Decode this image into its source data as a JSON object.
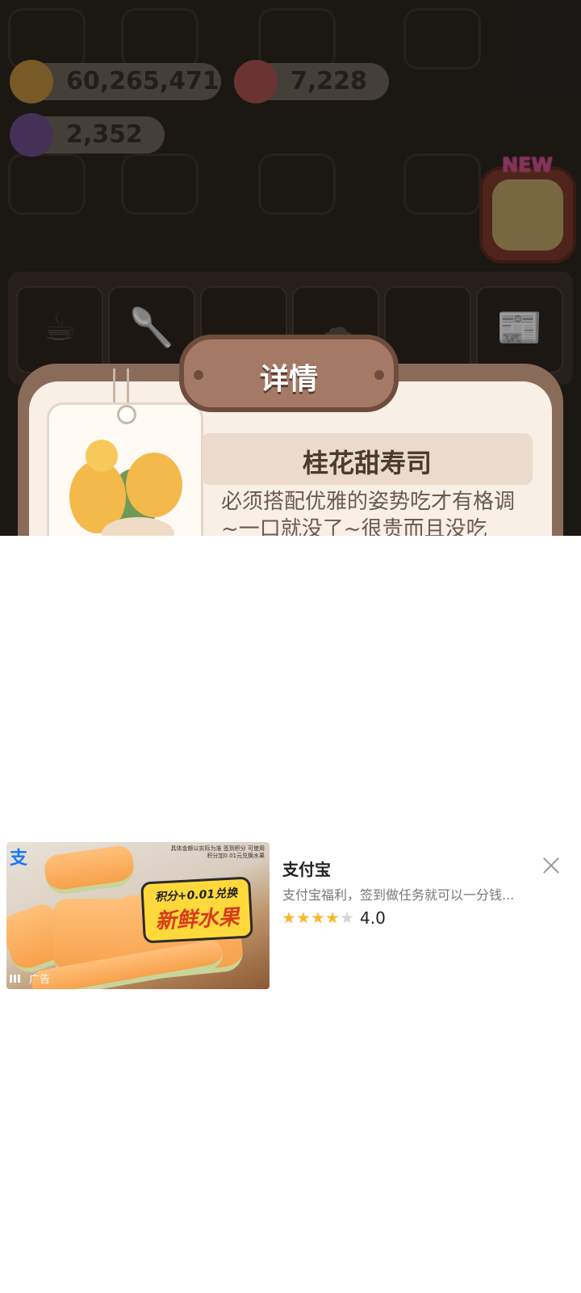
{
  "resources": {
    "coins": "60,265,471",
    "gems": "7,228",
    "tickets": "2,352"
  },
  "new_badge": "NEW",
  "shelf_slots": [
    "cup-icon",
    "utensils-icon",
    "empty-slot",
    "character-icon",
    "empty-slot",
    "newspaper-icon"
  ],
  "details": {
    "title": "详情",
    "item_name": "桂花甜寿司",
    "description": "必须搭配优雅的姿势吃才有格调~一口就没了~很贵而且没吃"
  },
  "ad": {
    "brand_mark": "支",
    "small_print": "具体金额以实际为准 签到积分 可使用积分加0.01元兑换水果",
    "badge_line1": "积分+0.01兑换",
    "badge_line2": "新鲜水果",
    "ad_label": "广告",
    "app_name": "支付宝",
    "app_desc": "支付宝福利，签到做任务就可以一分钱...",
    "rating": "4.0",
    "stars_filled": 4,
    "stars_total": 5
  }
}
